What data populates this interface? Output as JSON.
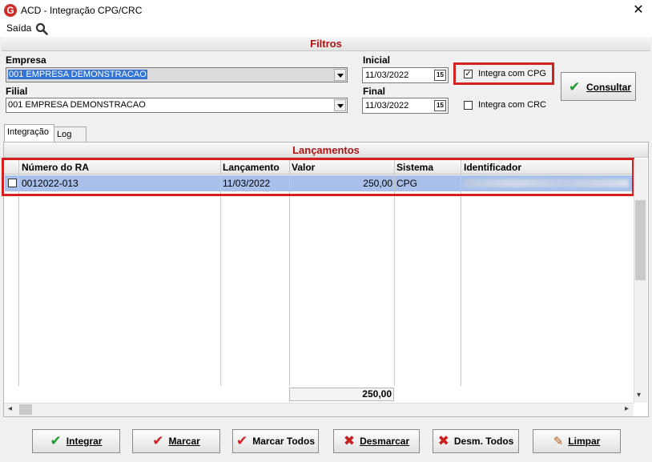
{
  "window": {
    "title": "ACD - Integração CPG/CRC",
    "logo_letter": "G",
    "close_glyph": "✕"
  },
  "menu": {
    "saida": "Saída"
  },
  "filtros": {
    "header": "Filtros",
    "empresa_label": "Empresa",
    "empresa_value": "001 EMPRESA DEMONSTRACAO",
    "filial_label": "Filial",
    "filial_value": "001 EMPRESA DEMONSTRACAO",
    "inicial_label": "Inicial",
    "inicial_value": "11/03/2022",
    "final_label": "Final",
    "final_value": "11/03/2022",
    "calendar_glyph": "15",
    "integra_cpg_label": "Integra com CPG",
    "integra_cpg_checked": true,
    "integra_crc_label": "Integra com CRC",
    "integra_crc_checked": false,
    "consultar_label": "Consultar"
  },
  "tabs": [
    {
      "label": "Integração",
      "active": true
    },
    {
      "label": "Log",
      "active": false
    }
  ],
  "lancamentos": {
    "header": "Lançamentos",
    "columns": [
      "Número do RA",
      "Lançamento",
      "Valor",
      "Sistema",
      "Identificador"
    ],
    "rows": [
      {
        "checked": false,
        "numero_ra": "0012022-013",
        "lancamento": "11/03/2022",
        "valor": "250,00",
        "sistema": "CPG",
        "identificador": ""
      }
    ],
    "total": "250,00"
  },
  "buttons": {
    "integrar": "Integrar",
    "marcar": "Marcar",
    "marcar_todos": "Marcar Todos",
    "desmarcar": "Desmarcar",
    "desm_todos": "Desm. Todos",
    "limpar": "Limpar"
  },
  "colors": {
    "accent_red": "#d42020",
    "header_text": "#b01212",
    "row_selected": "#a8c0ea",
    "check_green": "#1e9a2e"
  },
  "icons": [
    "app-logo-icon",
    "close-icon",
    "search-icon",
    "checkmark-icon",
    "red-checkmark-icon",
    "x-icon",
    "brush-icon",
    "calendar-icon",
    "scroll-arrow-icon"
  ]
}
